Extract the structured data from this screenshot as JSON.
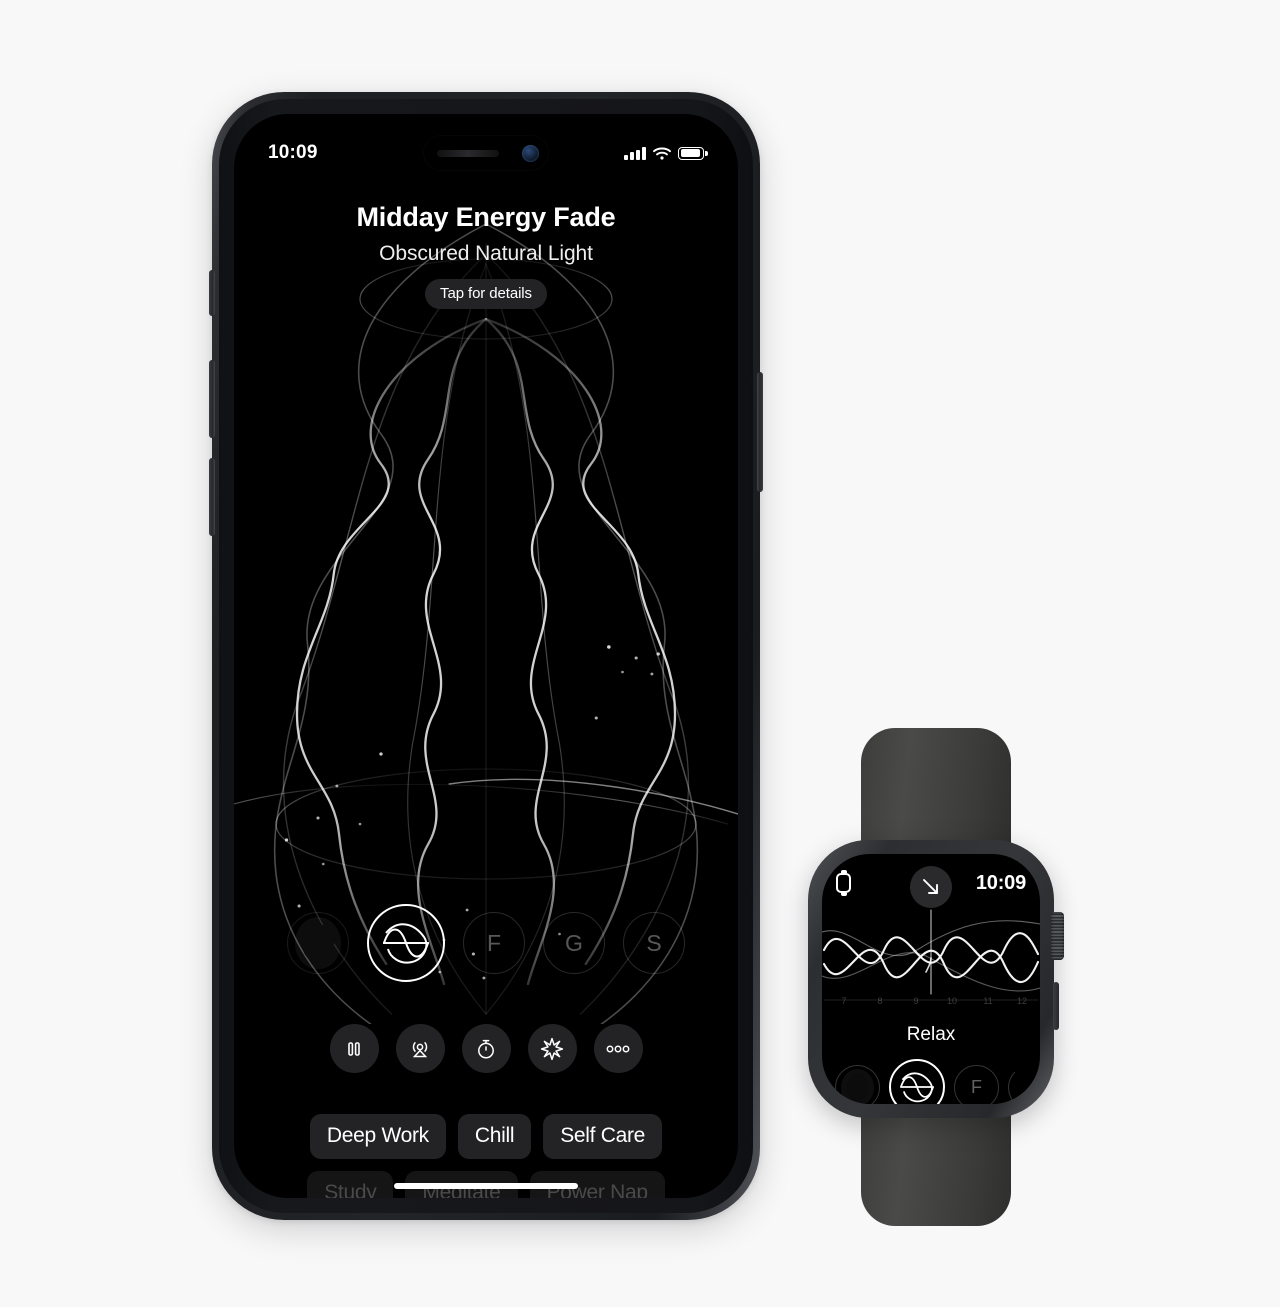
{
  "background_color": "#f7f7f8",
  "phone": {
    "status_bar": {
      "time": "10:09",
      "cellular_icon": "signal-bars-icon",
      "wifi_icon": "wifi-icon",
      "battery_icon": "battery-icon"
    },
    "header": {
      "title": "Midday Energy Fade",
      "subtitle": "Obscured Natural Light",
      "details_button": "Tap for details"
    },
    "sound_selector": [
      {
        "label": "",
        "icon": "blob-sound-icon",
        "selected": false
      },
      {
        "label": "",
        "icon": "wave-circle-icon",
        "selected": true
      },
      {
        "label": "F",
        "icon": "letter-f-icon",
        "selected": false
      },
      {
        "label": "G",
        "icon": "letter-g-icon",
        "selected": false
      },
      {
        "label": "S",
        "icon": "letter-s-icon",
        "selected": false
      }
    ],
    "controls": [
      {
        "name": "pause-button",
        "icon": "pause-icon"
      },
      {
        "name": "airplay-button",
        "icon": "airplay-icon"
      },
      {
        "name": "timer-button",
        "icon": "stopwatch-icon"
      },
      {
        "name": "effects-button",
        "icon": "starburst-icon"
      },
      {
        "name": "more-button",
        "icon": "ellipsis-icon"
      }
    ],
    "presets_row_1": [
      "Deep Work",
      "Chill",
      "Self Care"
    ],
    "presets_row_2": [
      "Study",
      "Meditate",
      "Power Nap"
    ]
  },
  "watch": {
    "status": {
      "app_icon": "watch-outline-icon",
      "arrow_icon": "arrow-down-right-icon",
      "time": "10:09"
    },
    "timeline_hours": [
      "7",
      "8",
      "9",
      "10",
      "11",
      "12"
    ],
    "label": "Relax",
    "sound_selector": [
      {
        "label": "",
        "icon": "blob-sound-icon",
        "selected": false
      },
      {
        "label": "",
        "icon": "wave-circle-icon",
        "selected": true
      },
      {
        "label": "F",
        "icon": "letter-f-icon",
        "selected": false
      },
      {
        "label": "",
        "icon": "partial-circle-icon",
        "selected": false
      }
    ]
  }
}
